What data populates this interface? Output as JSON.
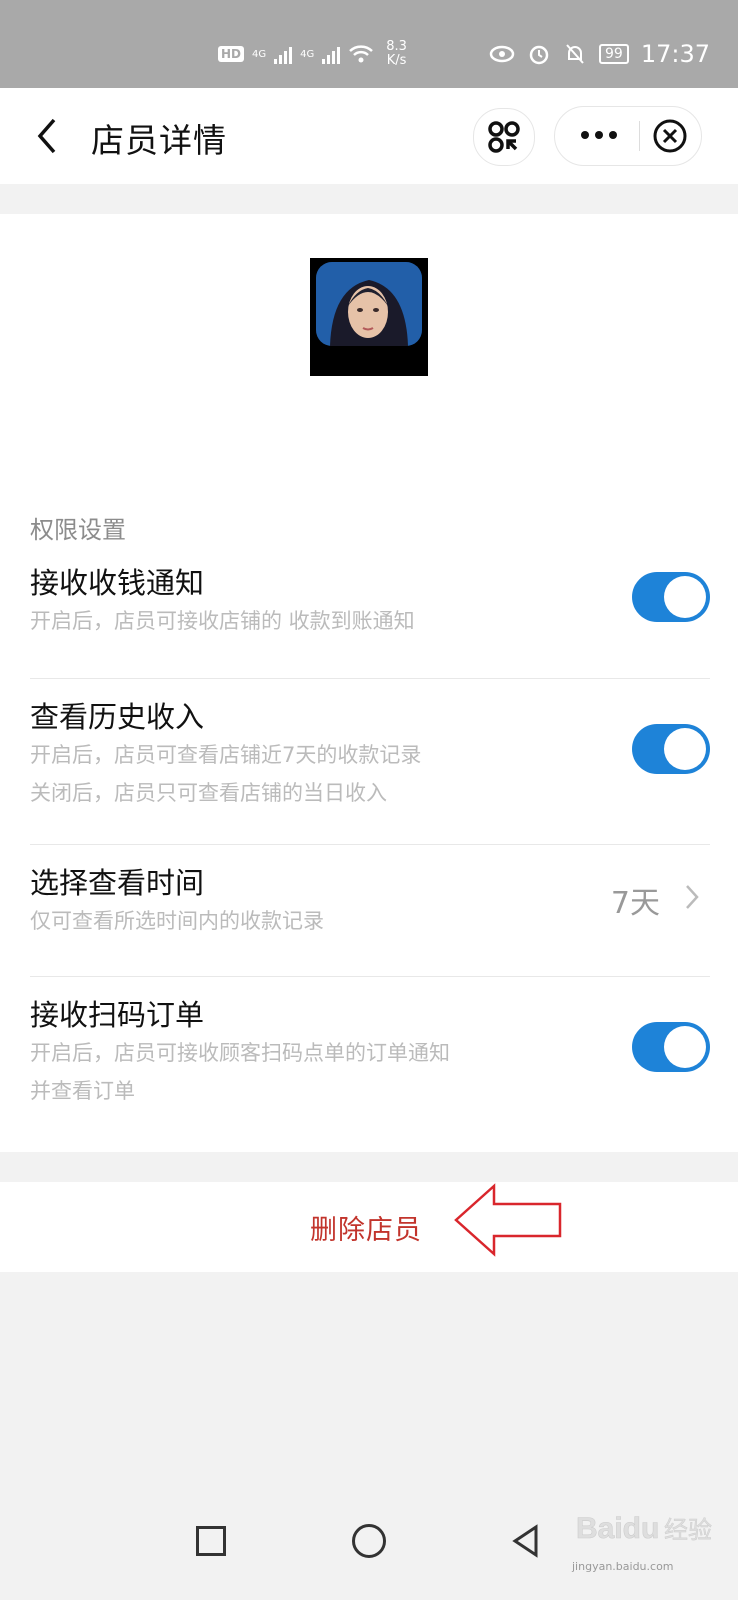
{
  "status": {
    "network1": "4G",
    "network2": "4G",
    "speed_value": "8.3",
    "speed_unit": "K/s",
    "battery": "99",
    "time": "17:37"
  },
  "nav": {
    "title": "店员详情"
  },
  "permissions": {
    "section_title": "权限设置",
    "items": [
      {
        "title": "接收收钱通知",
        "desc": [
          "开启后，店员可接收店铺的 收款到账通知"
        ],
        "enabled": true
      },
      {
        "title": "查看历史收入",
        "desc": [
          "开启后，店员可查看店铺近7天的收款记录",
          "关闭后，店员只可查看店铺的当日收入"
        ],
        "enabled": true
      },
      {
        "title": "选择查看时间",
        "desc": [
          "仅可查看所选时间内的收款记录"
        ],
        "value": "7天"
      },
      {
        "title": "接收扫码订单",
        "desc": [
          "开启后，店员可接收顾客扫码点单的订单通知",
          "并查看订单"
        ],
        "enabled": true
      }
    ]
  },
  "actions": {
    "delete_label": "删除店员"
  },
  "colors": {
    "accent_blue": "#1e83d8",
    "danger_red": "#c2342c",
    "annotation_red": "#d9262c"
  },
  "watermark": {
    "text": "jingyan.baidu.com",
    "logo": "Baidu经验"
  }
}
